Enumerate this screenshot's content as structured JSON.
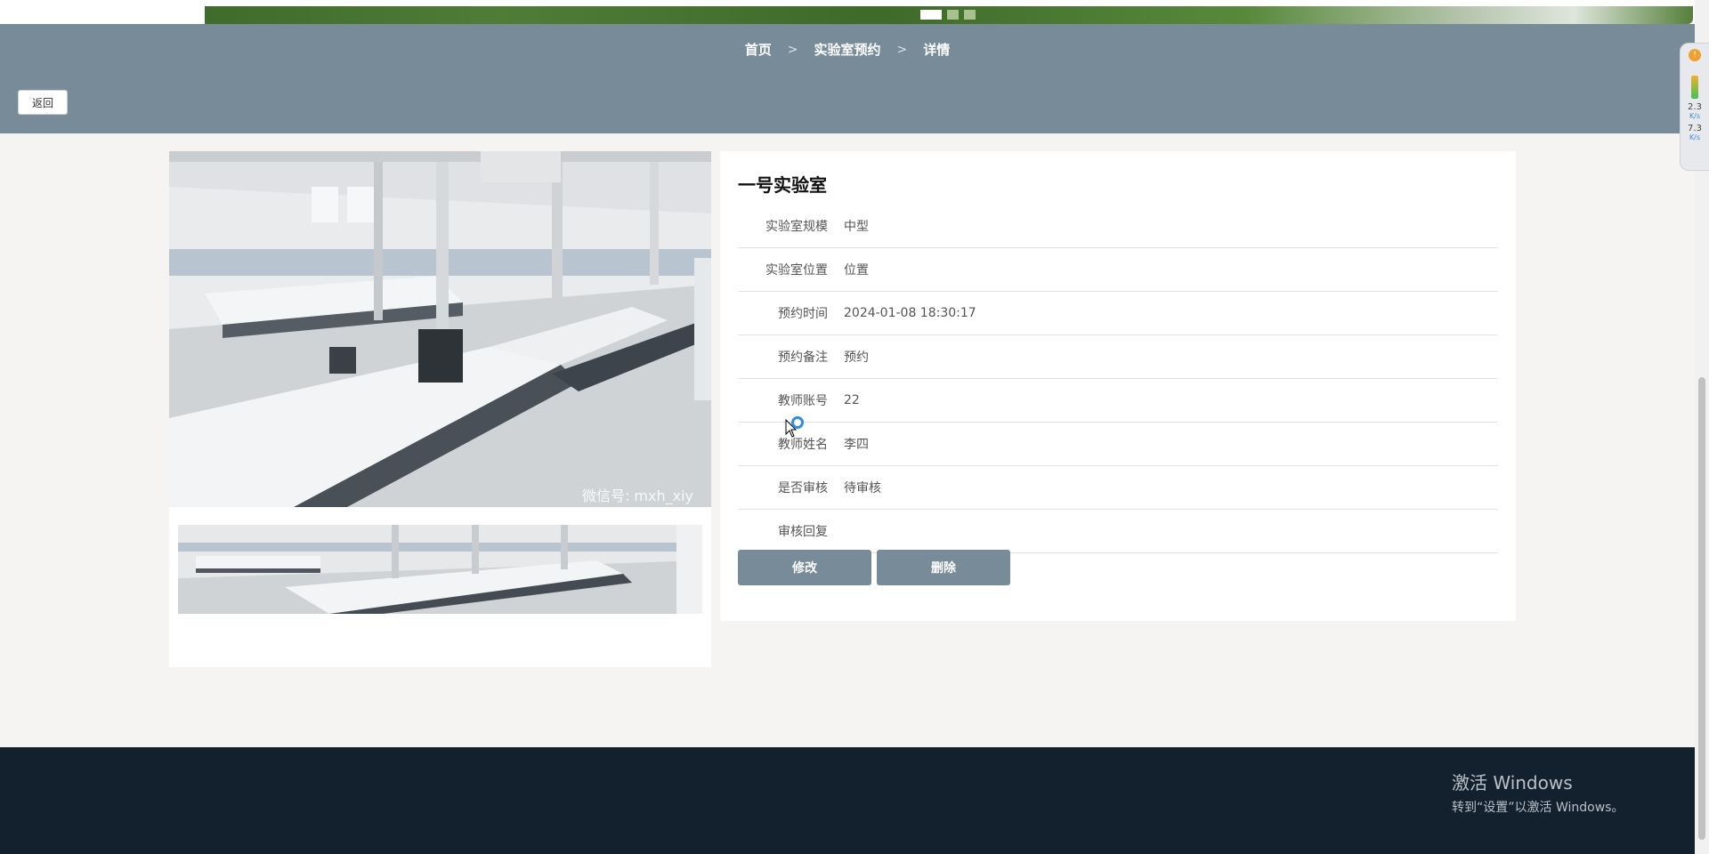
{
  "breadcrumb": {
    "home": "首页",
    "section": "实验室预约",
    "current": "详情",
    "separator": ">"
  },
  "back_label": "返回",
  "carousel": {
    "slides": 3,
    "active_index": 0
  },
  "lab": {
    "title": "一号实验室",
    "watermark": "微信号: mxh_xiy",
    "fields": [
      {
        "label": "实验室规模",
        "value": "中型"
      },
      {
        "label": "实验室位置",
        "value": "位置"
      },
      {
        "label": "预约时间",
        "value": "2024-01-08 18:30:17"
      },
      {
        "label": "预约备注",
        "value": "预约"
      },
      {
        "label": "教师账号",
        "value": "22"
      },
      {
        "label": "教师姓名",
        "value": "李四"
      },
      {
        "label": "是否审核",
        "value": "待审核"
      },
      {
        "label": "审核回复",
        "value": ""
      }
    ]
  },
  "actions": {
    "edit": "修改",
    "delete": "删除"
  },
  "windows_activation": {
    "title": "激活 Windows",
    "subtitle": "转到“设置”以激活 Windows。"
  },
  "net_widget": {
    "badge": "!",
    "upload": "2.3",
    "upload_unit": "K/s",
    "download": "7.3",
    "download_unit": "K/s"
  },
  "colors": {
    "header_band": "#778b99",
    "button": "#778b99",
    "footer": "#13212f",
    "page_bg": "#f5f4f3"
  }
}
